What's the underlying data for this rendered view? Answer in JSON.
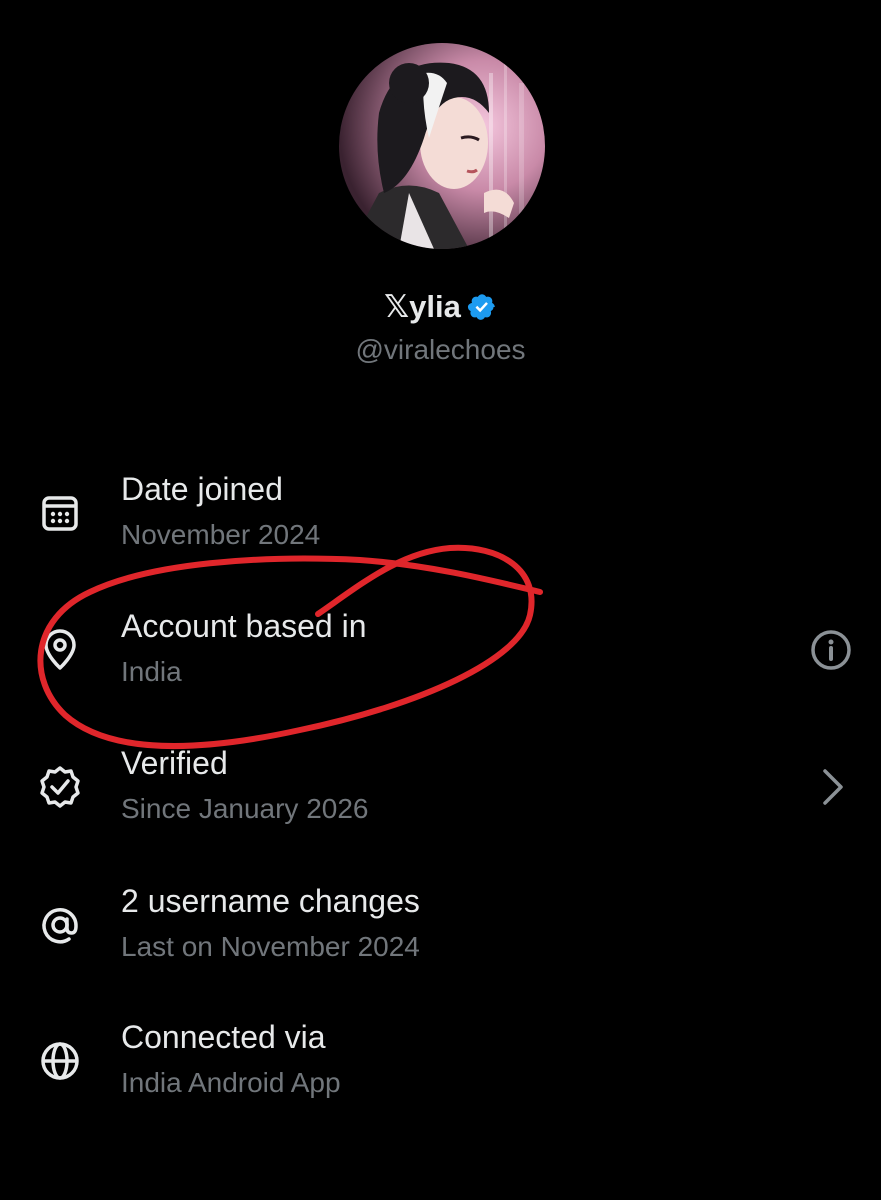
{
  "profile": {
    "display_name": "𝕏ylia",
    "handle": "@viralechoes",
    "avatar_icon": "anime-portrait-avatar",
    "verified_icon": "verified-badge-icon",
    "badge_color": "#1d9bf0"
  },
  "about_rows": [
    {
      "icon": "calendar-icon",
      "title": "Date joined",
      "subtitle": "November 2024",
      "right_icon": ""
    },
    {
      "icon": "location-pin-icon",
      "title": "Account based in",
      "subtitle": "India",
      "right_icon": "info-icon"
    },
    {
      "icon": "verified-check-icon",
      "title": "Verified",
      "subtitle": "Since January 2026",
      "right_icon": "chevron-right-icon"
    },
    {
      "icon": "at-sign-icon",
      "title": "2 username changes",
      "subtitle": "Last on November 2024",
      "right_icon": ""
    },
    {
      "icon": "globe-icon",
      "title": "Connected via",
      "subtitle": "India Android App",
      "right_icon": ""
    }
  ],
  "colors": {
    "background": "#000000",
    "primary_text": "#e7e9ea",
    "secondary_text": "#71767b",
    "annotation": "#e0262b"
  },
  "annotation": {
    "type": "hand-drawn-circle",
    "target": "Account based in"
  }
}
